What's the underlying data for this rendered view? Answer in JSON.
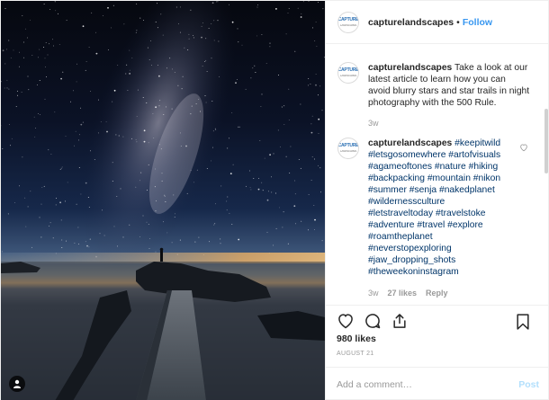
{
  "header": {
    "username": "capturelandscapes",
    "separator": "•",
    "follow_label": "Follow"
  },
  "avatar_logo": {
    "line1": "CAPTURE",
    "line2": "LANDSCAPES"
  },
  "caption": {
    "username": "capturelandscapes",
    "text": "Take a look at our latest article to learn how you can avoid blurry stars and star trails in night photography with the 500 Rule.",
    "time": "3w"
  },
  "hashtag_comment": {
    "username": "capturelandscapes",
    "first_tag": "#keepitwild",
    "tags": [
      "#letsgosomewhere #artofvisuals",
      "#agameoftones #nature #hiking",
      "#backpacking #mountain #nikon",
      "#summer #senja #nakedplanet",
      "#wildernessculture",
      "#letstraveltoday #travelstoke",
      "#adventure #travel #explore",
      "#roamtheplanet",
      "#neverstopexploring",
      "#jaw_dropping_shots",
      "#theweekoninstagram"
    ],
    "time": "3w",
    "likes": "27 likes",
    "reply_label": "Reply"
  },
  "post": {
    "likes": "980 likes",
    "date": "AUGUST 21"
  },
  "add_comment": {
    "placeholder": "Add a comment…",
    "post_label": "Post"
  },
  "icons": [
    "heart-icon",
    "comment-icon",
    "share-icon",
    "bookmark-icon",
    "user-tag-icon"
  ],
  "colors": {
    "link": "#3897f0",
    "hashtag": "#003569",
    "post_disabled": "#b2dffc",
    "muted": "#999999"
  }
}
